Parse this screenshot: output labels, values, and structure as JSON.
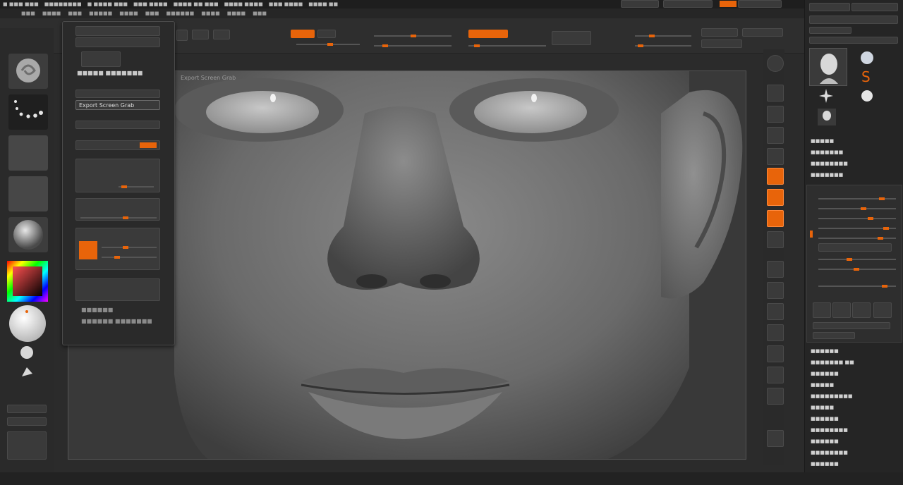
{
  "panel": {
    "title": "Export Screen Grab",
    "grab_label": "Export Screen Grab"
  },
  "colors": {
    "accent": "#e8640a",
    "bg": "#2b2b2b",
    "panel": "#343434"
  },
  "icons": {
    "tool_brush": "brush-icon",
    "alpha": "alpha-dots-icon",
    "material": "sphere-material-icon",
    "head": "head-tool-icon",
    "star": "star-tool-icon"
  }
}
